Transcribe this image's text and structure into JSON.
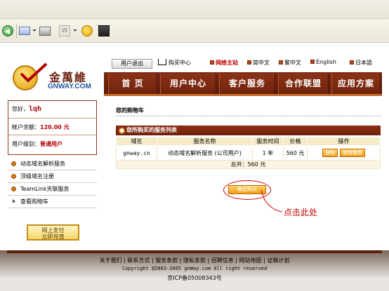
{
  "logo": {
    "cn": "金萬維",
    "en": "GNWAY.COM"
  },
  "util": {
    "logout": "用户退出",
    "cart": "购买中心",
    "langs": [
      {
        "label": "网络主站",
        "red": true
      },
      {
        "label": "简中文",
        "red": false
      },
      {
        "label": "繁中文",
        "red": false
      },
      {
        "label": "English",
        "red": false
      },
      {
        "label": "日本語",
        "red": false
      }
    ]
  },
  "nav": {
    "items": [
      "首 页",
      "用户中心",
      "客户服务",
      "合作联盟",
      "应用方案"
    ]
  },
  "account": {
    "greet_label": "您好，",
    "username": "lqh",
    "balance_label": "帐户余额：",
    "balance": "120.00 元",
    "level_label": "用户级别：",
    "level": "普通用户"
  },
  "side_menu": {
    "items": [
      "动态域名解析服务",
      "顶级域名注册",
      "TeamLink天联服务",
      "查看购物车"
    ]
  },
  "pay_badge": {
    "line1": "网上支付",
    "line2": "立即充值"
  },
  "cart": {
    "title": "您的购物车",
    "list_title": "您所购买的服务列表",
    "columns": [
      "域名",
      "服务名称",
      "服务时间",
      "价格",
      "操作"
    ],
    "rows": [
      {
        "domain": "gnway.cn",
        "service": "动态域名解析服务 (公司用户)",
        "time": "1 年",
        "price": "560 元",
        "del": "删除",
        "coupon": "使用赠券"
      }
    ],
    "total": "总共：560 元",
    "confirm": "确定购买"
  },
  "annotation": "点击此处",
  "footer": {
    "links": "关于我们 | 联系方式 | 服务条款 | 隐私条款 | 招聘信息 | 网站地图 | 证稿计划",
    "copyright": "Copyright @2003-2005 gnWay.com All right reserved",
    "icp": "京ICP备05008343号"
  }
}
